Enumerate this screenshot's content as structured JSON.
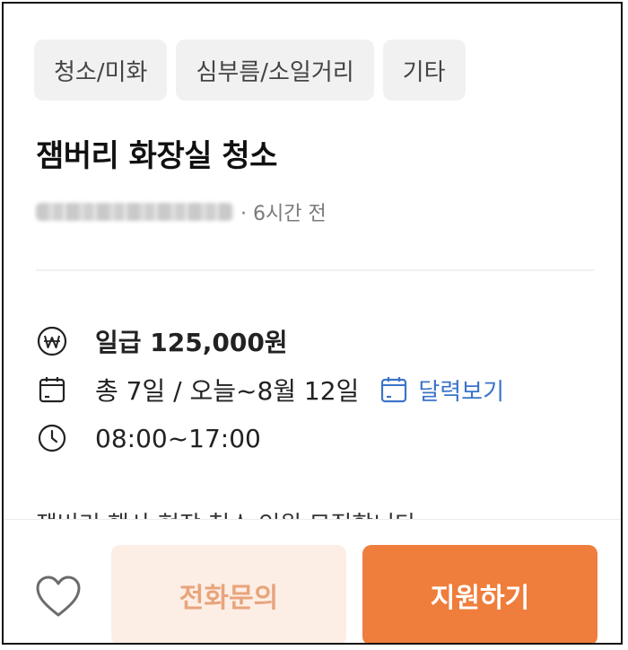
{
  "tags": [
    "청소/미화",
    "심부름/소일거리",
    "기타"
  ],
  "post": {
    "title": "잼버리 화장실 청소",
    "posted_ago": "· 6시간 전"
  },
  "details": {
    "pay": "일급 125,000원",
    "date": "총 7일 / 오늘~8월 12일",
    "calendar_link": "달력보기",
    "time": "08:00~17:00"
  },
  "description_preview": "잼버리 행사 현장 청소 인원 모집합니다",
  "actions": {
    "call_label": "전화문의",
    "apply_label": "지원하기"
  },
  "colors": {
    "accent": "#ef7d3b",
    "accent_light": "#fdeee5",
    "link": "#3b73c8"
  }
}
